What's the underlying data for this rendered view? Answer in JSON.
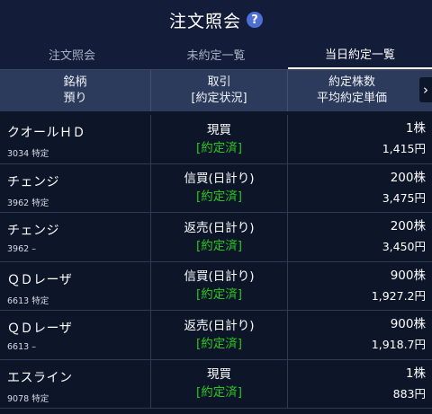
{
  "header": {
    "title": "注文照会"
  },
  "tabs": [
    {
      "label": "注文照会"
    },
    {
      "label": "未約定一覧"
    },
    {
      "label": "当日約定一覧"
    }
  ],
  "table_header": {
    "col1": {
      "line1": "銘柄",
      "line2": "預り"
    },
    "col2": {
      "line1": "取引",
      "line2": "[約定状況]"
    },
    "col3": {
      "line1": "約定株数",
      "line2": "平均約定単価"
    }
  },
  "rows": [
    {
      "name": "クオールＨＤ",
      "code": "3034 特定",
      "trade": "現買",
      "status": "[約定済]",
      "qty": "1株",
      "price": "1,415円"
    },
    {
      "name": "チェンジ",
      "code": "3962 特定",
      "trade": "信買(日計り)",
      "status": "[約定済]",
      "qty": "200株",
      "price": "3,475円"
    },
    {
      "name": "チェンジ",
      "code": "3962 –",
      "trade": "返売(日計り)",
      "status": "[約定済]",
      "qty": "200株",
      "price": "3,450円"
    },
    {
      "name": "ＱＤレーザ",
      "code": "6613 特定",
      "trade": "信買(日計り)",
      "status": "[約定済]",
      "qty": "900株",
      "price": "1,927.2円"
    },
    {
      "name": "ＱＤレーザ",
      "code": "6613 –",
      "trade": "返売(日計り)",
      "status": "[約定済]",
      "qty": "900株",
      "price": "1,918.7円"
    },
    {
      "name": "エスライン",
      "code": "9078 特定",
      "trade": "現買",
      "status": "[約定済]",
      "qty": "1株",
      "price": "883円"
    }
  ],
  "icons": {
    "help": "question-circle-icon",
    "scroll": "chevron-right-icon"
  },
  "colors": {
    "status_green": "#27c61e",
    "background": "#0d1629",
    "header_bg": "#2c3b5c"
  }
}
